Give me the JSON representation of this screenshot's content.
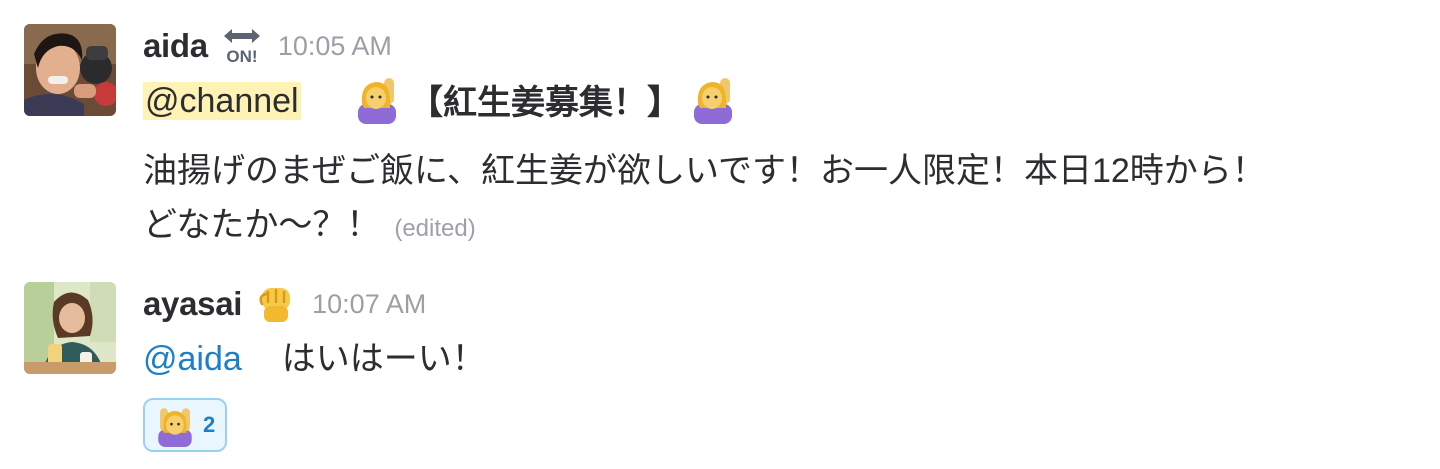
{
  "messages": [
    {
      "sender": "aida",
      "status_emoji": "on-arrow-icon",
      "status_label": "ON!",
      "time": "10:05 AM",
      "mention": "@channel",
      "title": "【紅生姜募集！】",
      "body_line1": "油揚げのまぜご飯に、紅生姜が欲しいです！お一人限定！本日12時から！",
      "body_line2": "どなたか〜？！",
      "edited": "(edited)"
    },
    {
      "sender": "ayasai",
      "status_emoji": "raised-fist-icon",
      "time": "10:07 AM",
      "mention": "@aida",
      "text": "はいはーい！",
      "reaction": {
        "emoji": "woman-raising-hand-icon",
        "count": "2"
      }
    }
  ],
  "colors": {
    "mention_user": "#1d7fc7",
    "mention_channel_bg": "#fff2b5",
    "timestamp": "#9e9ea6",
    "reaction_border": "#9ad1f3",
    "reaction_bg": "#eaf6fd"
  }
}
